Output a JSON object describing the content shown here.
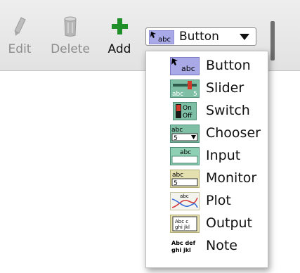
{
  "toolbar": {
    "edit_label": "Edit",
    "delete_label": "Delete",
    "add_label": "Add",
    "edit_icon": "pencil-icon",
    "delete_icon": "trash-icon",
    "add_icon": "plus-icon",
    "add_icon_color": "#1f8f2a",
    "disabled_color": "#8c8c8c"
  },
  "widget_select": {
    "selected_label": "Button",
    "selected_icon": "button-widget-icon",
    "selected_icon_text": "abc"
  },
  "menu": {
    "items": [
      {
        "label": "Button",
        "icon": "button-widget-icon",
        "icon_text": "abc"
      },
      {
        "label": "Slider",
        "icon": "slider-widget-icon",
        "icon_text": "abc",
        "icon_value": "5"
      },
      {
        "label": "Switch",
        "icon": "switch-widget-icon",
        "icon_text_on": "On",
        "icon_text_off": "Off"
      },
      {
        "label": "Chooser",
        "icon": "chooser-widget-icon",
        "icon_text": "abc",
        "icon_value": "5"
      },
      {
        "label": "Input",
        "icon": "input-widget-icon",
        "icon_text": "abc"
      },
      {
        "label": "Monitor",
        "icon": "monitor-widget-icon",
        "icon_text": "abc",
        "icon_value": "5"
      },
      {
        "label": "Plot",
        "icon": "plot-widget-icon",
        "icon_text": "abc"
      },
      {
        "label": "Output",
        "icon": "output-widget-icon",
        "icon_text": "Abc c",
        "icon_text2": "ghi jkl"
      },
      {
        "label": "Note",
        "icon": "note-widget-icon",
        "icon_text": "Abc def",
        "icon_text2": "ghi jkl"
      }
    ]
  }
}
